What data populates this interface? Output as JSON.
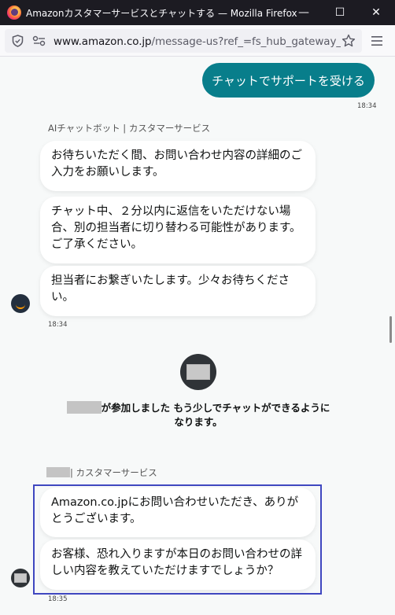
{
  "window": {
    "title": "Amazonカスタマーサービスとチャットする — Mozilla Firefox",
    "minimize": "—",
    "maximize": "☐",
    "close": "✕"
  },
  "navbar": {
    "url_domain": "www.amazon.co.jp",
    "url_path": "/message-us?ref_=fs_hub_gateway_mu&"
  },
  "chat": {
    "user_message": "チャットでサポートを受ける",
    "user_time": "18:34",
    "bot_sender": "AIチャットボット | カスタマーサービス",
    "bot_messages": [
      "お待ちいただく間、お問い合わせ内容の詳細のご入力をお願いします。",
      "チャット中、２分以内に返信をいただけない場合、別の担当者に切り替わる可能性があります。ご了承ください。",
      "担当者にお繋ぎいたします。少々お待ちください。"
    ],
    "bot_time": "18:34",
    "join_text": "が参加しました もう少しでチャットができるようになります。",
    "agent_sender": "| カスタマーサービス",
    "agent_messages": [
      "Amazon.co.jpにお問い合わせいただき、ありがとうございます。",
      "お客様、恐れ入りますが本日のお問い合わせの詳しい内容を教えていただけますでしょうか？"
    ],
    "agent_time": "18:35"
  }
}
